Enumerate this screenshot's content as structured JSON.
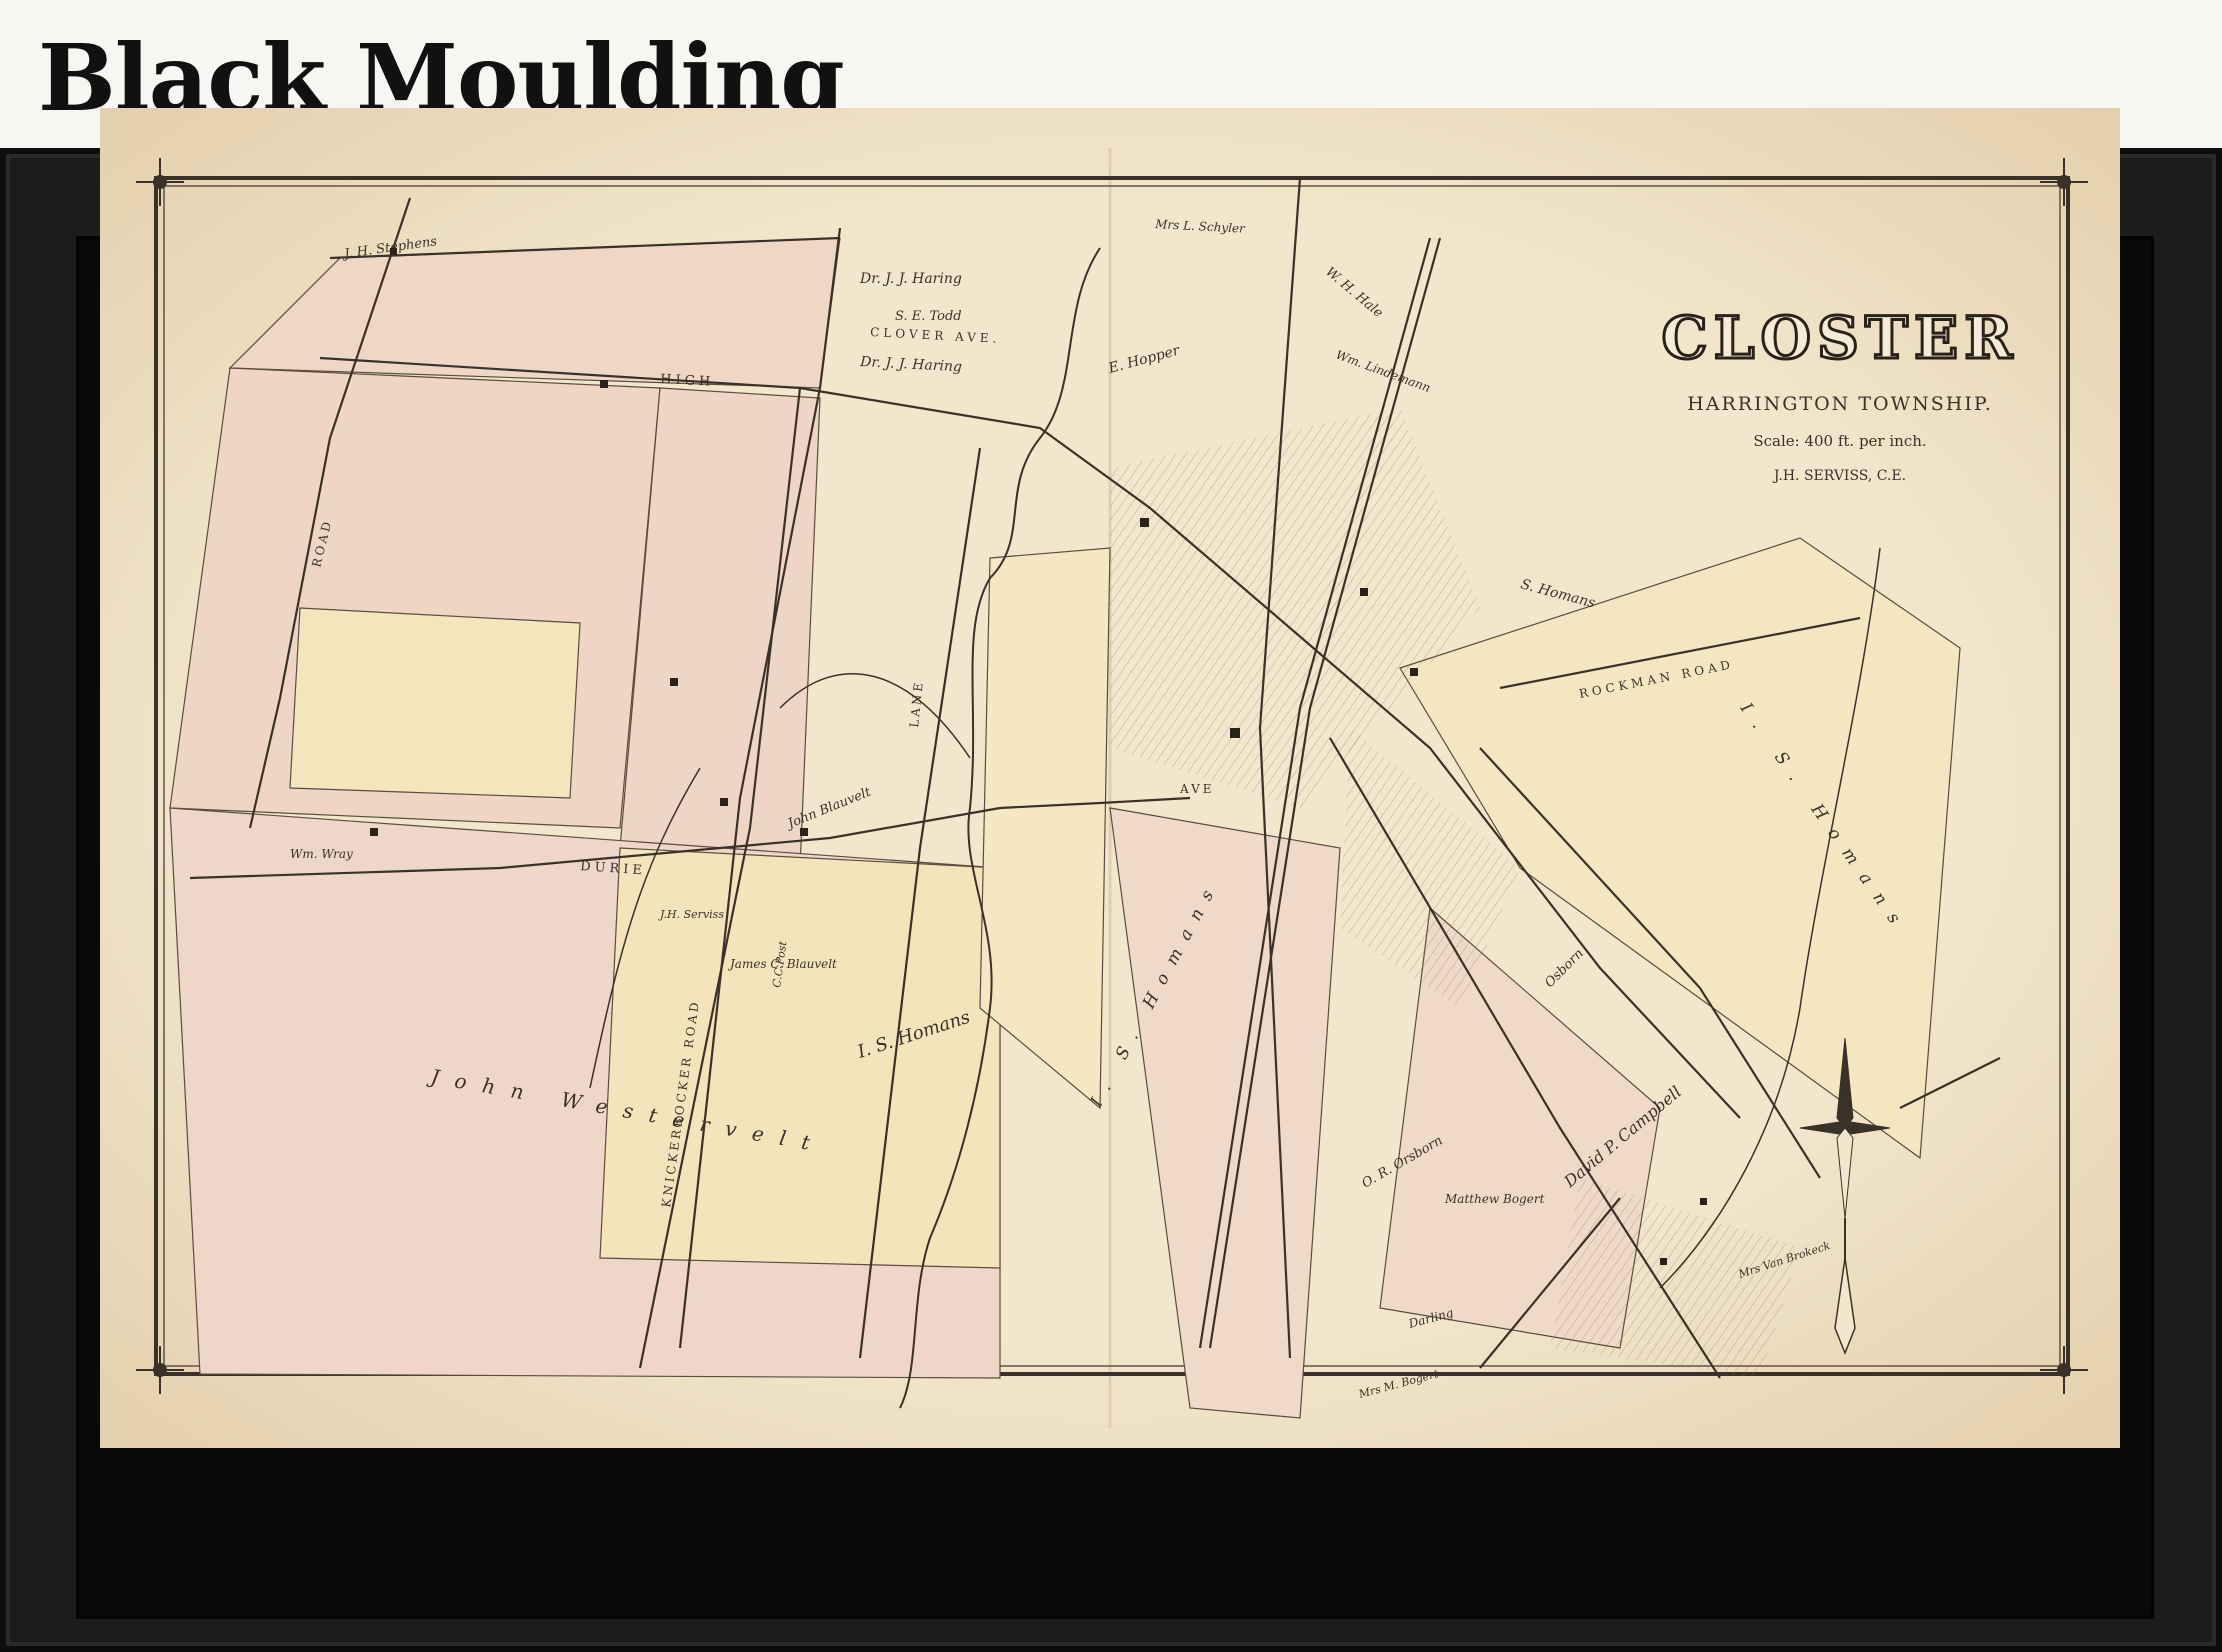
{
  "header": {
    "title": "Black Moulding"
  },
  "map": {
    "title": "CLOSTER",
    "subtitle": "HARRINGTON TOWNSHIP.",
    "scale": "Scale: 400 ft. per inch.",
    "author": "J.H. SERVISS, C.E.",
    "roads": {
      "high": "HIGH",
      "clover_ave": "CLOVER AVE.",
      "durie": "DURIE",
      "knickerbocker_road": "KNICKERBOCKER ROAD",
      "road_left": "ROAD",
      "rockman_road": "ROCKMAN ROAD",
      "lane": "LANE",
      "ave": "AVE"
    },
    "owners": {
      "j_h_stephens": "J. H. Stephens",
      "dr_j_j_haring_1": "Dr. J. J. Haring",
      "s_e_todd": "S. E. Todd",
      "dr_j_j_haring_2": "Dr. J. J. Haring",
      "mrs_l_schyler": "Mrs L. Schyler",
      "e_hopper": "E. Hopper",
      "w_h_hale": "W. H. Hale",
      "wm_lindemann": "Wm. Lindemann",
      "is_homans_right": "I. S. Homans",
      "is_homans_center": "I. S. Homans",
      "is_homans_left": "I. S. Homans",
      "s_homans": "S. Homans",
      "wm_wray": "Wm. Wray",
      "john_blauvelt": "John Blauvelt",
      "james_blauvelt": "James C. Blauvelt",
      "c_c_post": "C.C.Post",
      "j_h_serviss": "J.H. Serviss",
      "john_westervelt": "John Westervelt",
      "osborn": "Osborn",
      "o_r_orsborn": "O. R. Orsborn",
      "david_p_campbell": "David P. Campbell",
      "matthew_bogert": "Matthew Bogert",
      "darling": "Darling",
      "mrs_m_bogert": "Mrs M. Bogert",
      "mrs_van_brokeck": "Mrs Van Brokeck"
    }
  },
  "colors": {
    "frame": "#1c1c1c",
    "paper": "#f0e3c8",
    "parcel_pink": "#eed6c8",
    "parcel_yellow": "#f3e7bd",
    "ink": "#3a3128"
  },
  "icons": {
    "compass": "compass-rose-icon",
    "corner": "corner-ornament-icon"
  }
}
